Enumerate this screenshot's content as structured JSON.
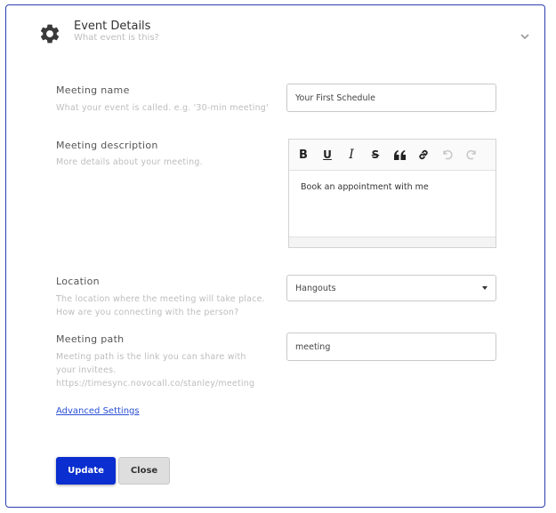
{
  "header": {
    "title": "Event Details",
    "subtitle": "What event is this?"
  },
  "meeting_name": {
    "label": "Meeting name",
    "help": "What your event is called. e.g. '30-min meeting'",
    "value": "Your First Schedule"
  },
  "meeting_description": {
    "label": "Meeting description",
    "help": "More details about your meeting.",
    "content": "Book an appointment with me",
    "toolbar": [
      "bold-icon",
      "underline-icon",
      "italic-icon",
      "strikethrough-icon",
      "quote-icon",
      "link-icon",
      "undo-icon",
      "redo-icon"
    ]
  },
  "location": {
    "label": "Location",
    "help_line1": "The location where the meeting will take place.",
    "help_line2": "How are you connecting with the person?",
    "selected": "Hangouts"
  },
  "meeting_path": {
    "label": "Meeting path",
    "help_line1": "Meeting path is the link you can share with",
    "help_line2": "your invitees.",
    "help_line3": "https://timesync.novocall.co/stanley/meeting",
    "value": "meeting"
  },
  "advanced_link": "Advanced Settings",
  "buttons": {
    "update": "Update",
    "close": "Close"
  },
  "colors": {
    "primary": "#0a2ecf",
    "border": "#2b3fb0",
    "link": "#2a4fd6"
  }
}
